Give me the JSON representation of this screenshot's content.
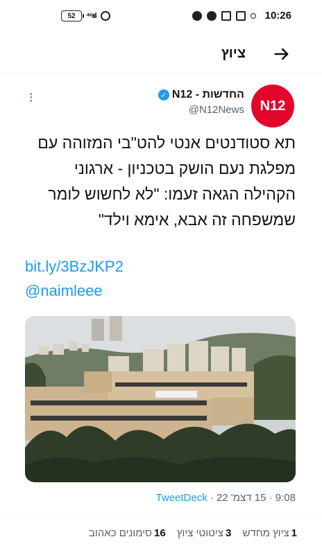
{
  "status_bar": {
    "battery": "52",
    "signal": "⁴⁶ııl",
    "time": "10:26"
  },
  "header": {
    "title": "ציוץ",
    "back_icon": "arrow-right-icon"
  },
  "tweet": {
    "author_name": "החדשות - N12",
    "handle": "@N12News",
    "avatar_text": "N12",
    "text": "תא סטודנטים אנטי להט\"בי המזוהה עם מפלגת נעם הושק בטכניון - ארגוני הקהילה הגאה זעמו: \"לא לחשוש לומר שמשפחה זה אבא, אימא וילד\"",
    "link_1": "bit.ly/3BzJKP2",
    "link_2": "@naimleee",
    "time": "9:08",
    "date": "15 דצמ' 22",
    "source": "TweetDeck",
    "sep": "·",
    "stats": {
      "retweets_count": "1",
      "retweets_label": "ציוץ מחדש",
      "quotes_count": "3",
      "quotes_label": "ציטוטי ציוץ",
      "likes_count": "16",
      "likes_label": "סימונים כאהוב"
    },
    "colors": {
      "brand": "#e3062b",
      "link": "#1d9bf0"
    }
  }
}
